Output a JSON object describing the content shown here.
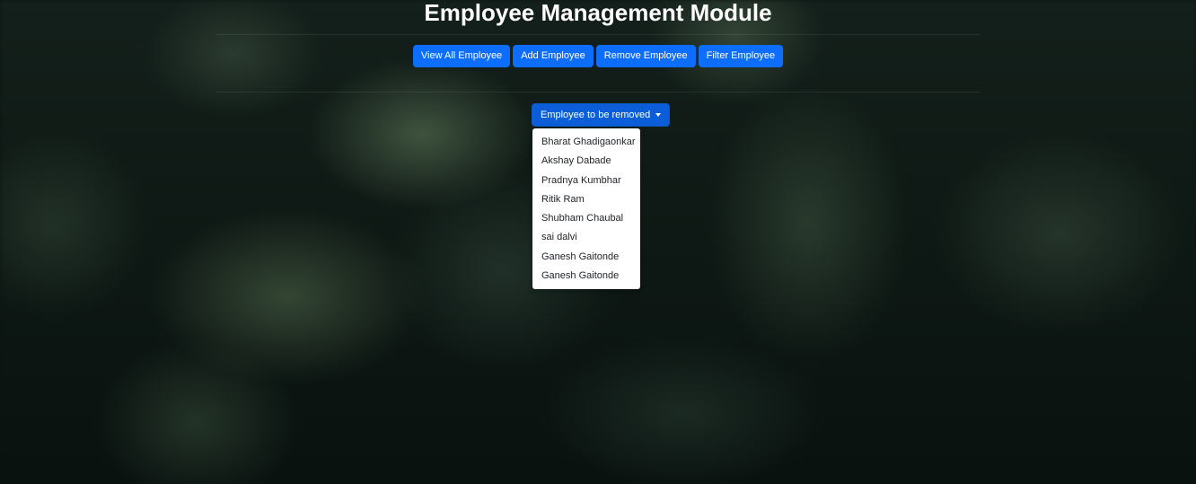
{
  "page": {
    "title": "Employee Management Module"
  },
  "nav": {
    "buttons": [
      {
        "label": "View All Employee"
      },
      {
        "label": "Add Employee"
      },
      {
        "label": "Remove Employee"
      },
      {
        "label": "Filter Employee"
      }
    ]
  },
  "dropdown": {
    "label": "Employee to be removed",
    "expanded": true,
    "items": [
      "Bharat Ghadigaonkar",
      "Akshay Dabade",
      "Pradnya Kumbhar",
      "Ritik Ram",
      "Shubham Chaubal",
      "sai dalvi",
      "Ganesh Gaitonde",
      "Ganesh Gaitonde"
    ]
  },
  "colors": {
    "primary_button": "#0d6efd",
    "active_button": "#0b5ed7",
    "background": "#0c1512",
    "menu_background": "#ffffff",
    "title_text": "#ffffff"
  },
  "icons": {
    "dropdown_caret": "caret-down-icon"
  }
}
